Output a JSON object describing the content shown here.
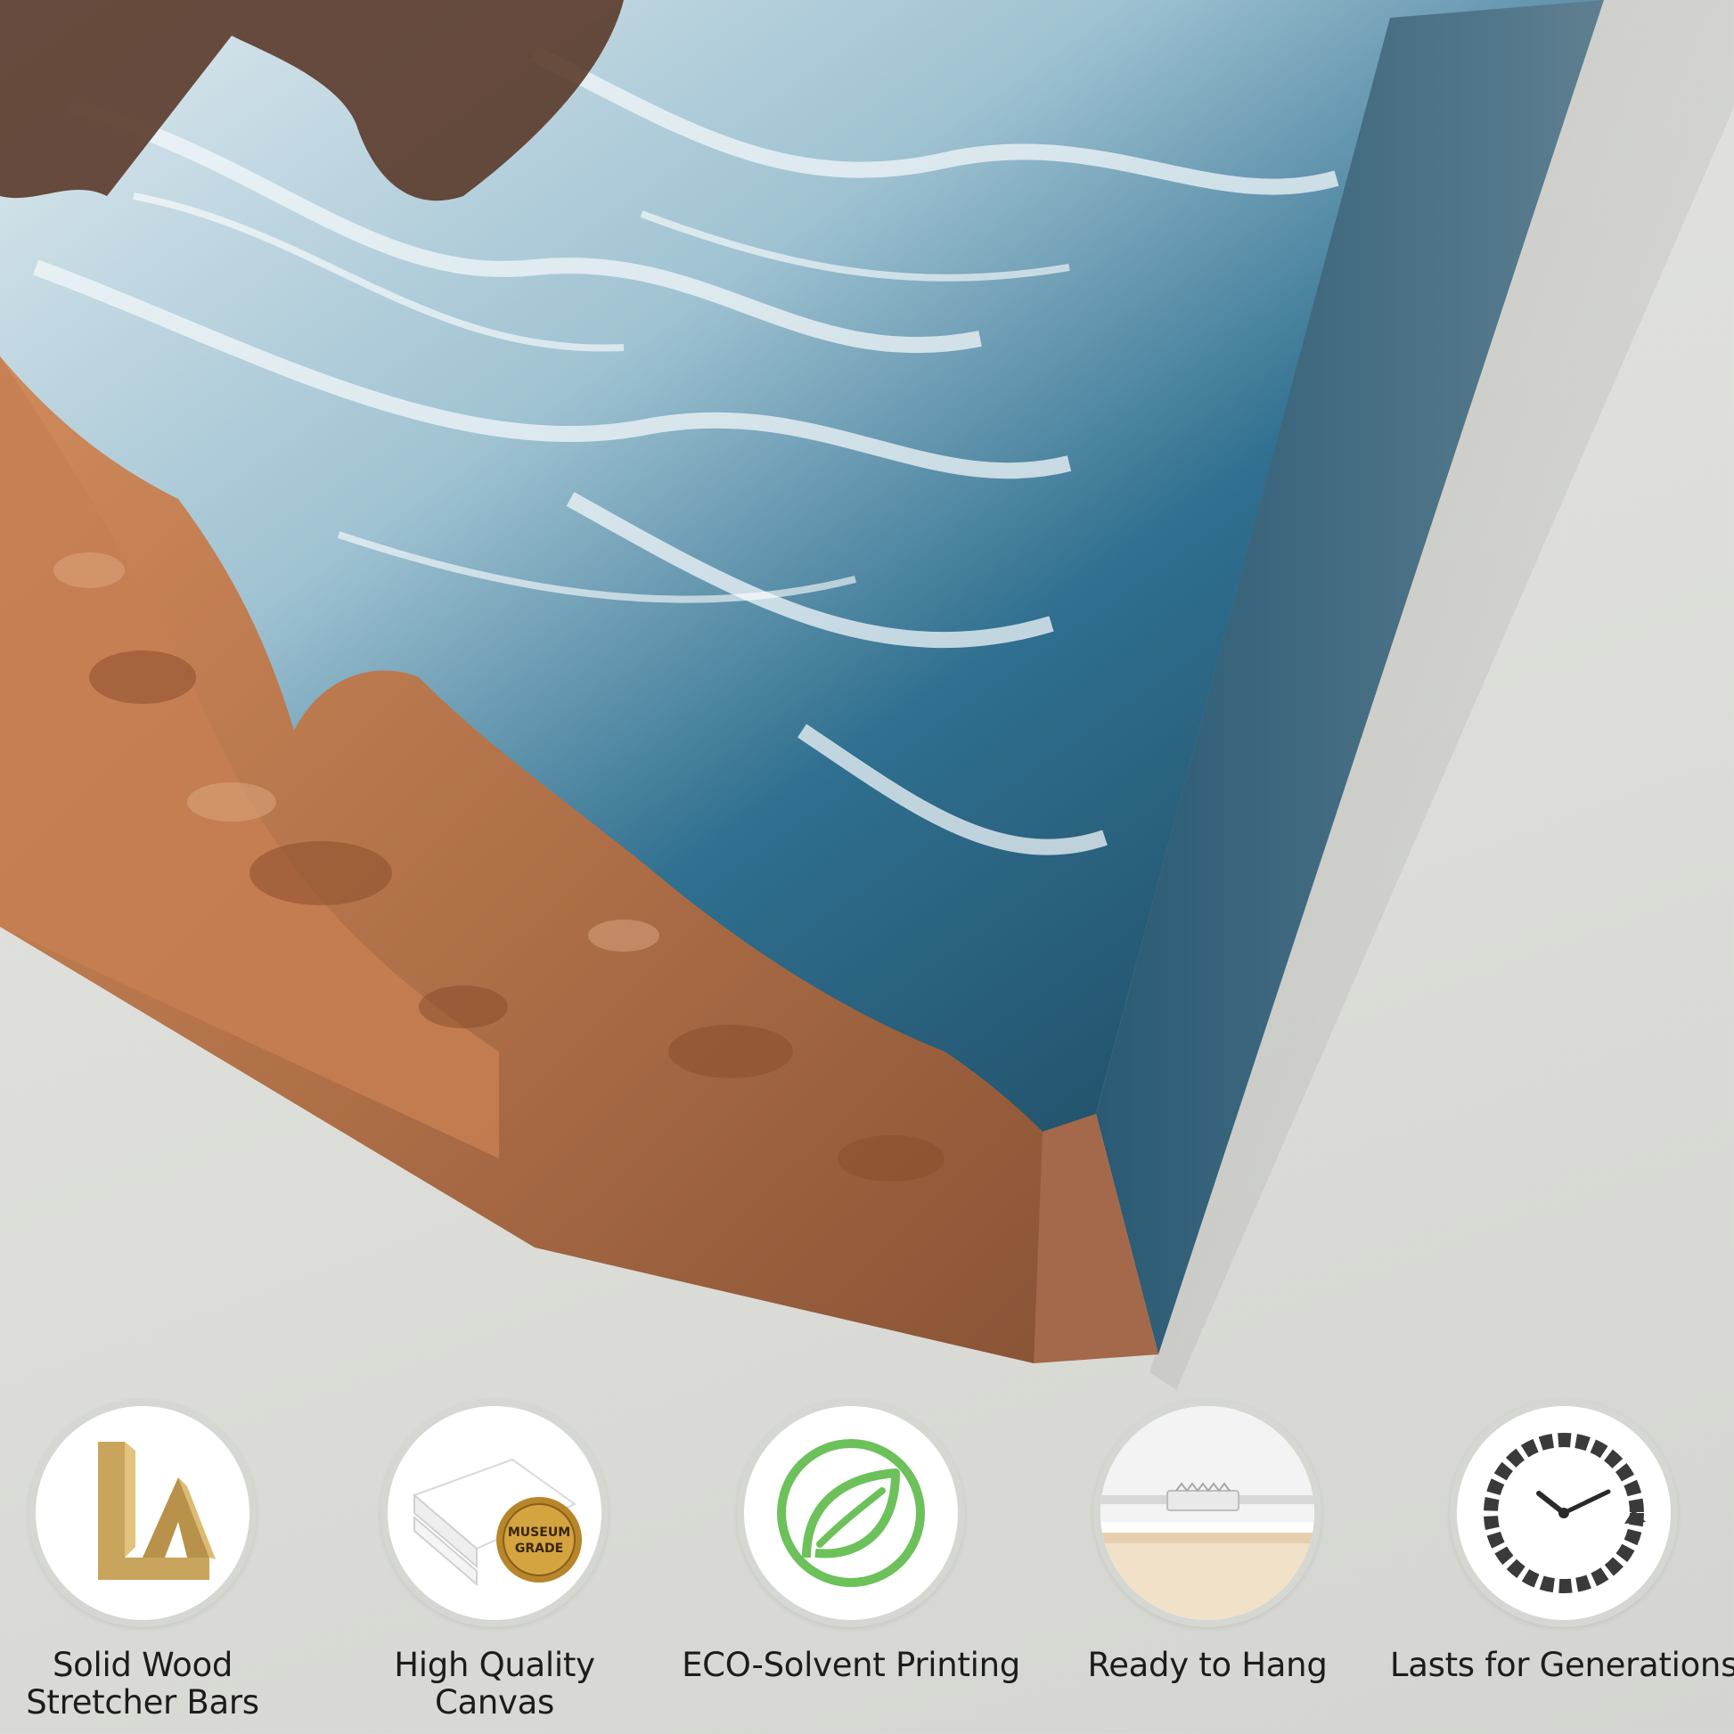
{
  "scene": {
    "subject": "canvas-print-corner",
    "colors": {
      "wall": "#dddeda",
      "ocean_deep": "#1f4a63",
      "ocean_mid": "#2f6f8f",
      "foam": "#eef4f6",
      "rock": "#b8754a",
      "rock_dark": "#7a4a30"
    }
  },
  "features": [
    {
      "label": "Solid Wood\nStretcher Bars",
      "icon": "stretcher-bar-icon"
    },
    {
      "label": "High Quality\nCanvas",
      "icon": "canvas-stack-icon",
      "seal_line1": "MUSEUM",
      "seal_line2": "GRADE"
    },
    {
      "label": "ECO-Solvent Printing",
      "icon": "leaf-icon",
      "icon_color": "#6cc15a"
    },
    {
      "label": "Ready to Hang",
      "icon": "hanger-icon"
    },
    {
      "label": "Lasts for Generations",
      "icon": "clock-icon"
    }
  ]
}
